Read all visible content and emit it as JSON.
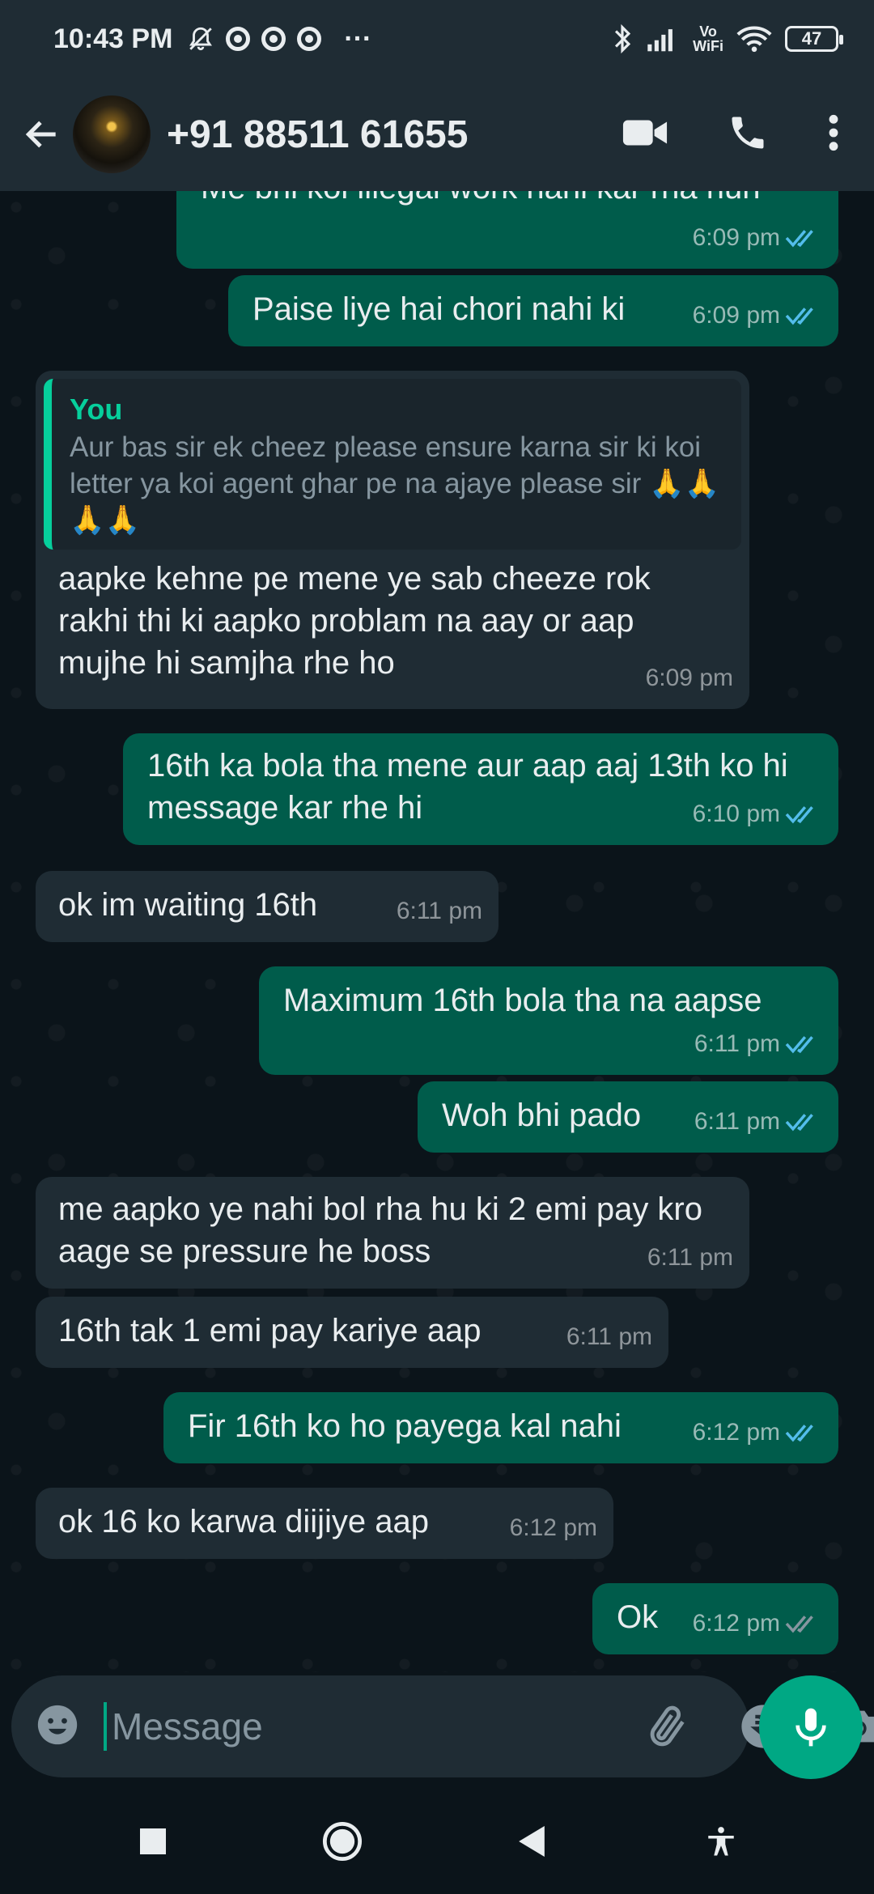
{
  "status_bar": {
    "time": "10:43 PM",
    "battery": "47",
    "volte": "Vo\nWiFi",
    "more": "···"
  },
  "header": {
    "contact_name": "+91 88511 61655"
  },
  "messages": [
    {
      "dir": "out",
      "text": "Me bhi koi illegal work nahi kar rha hun",
      "time": "6:09 pm",
      "status": "read"
    },
    {
      "dir": "out",
      "text": "Paise liye hai chori nahi ki",
      "time": "6:09 pm",
      "status": "read"
    },
    {
      "dir": "in",
      "quote_author": "You",
      "quote_text": "Aur bas sir ek cheez please ensure karna sir ki koi letter ya koi agent ghar pe na ajaye please sir 🙏🙏🙏🙏",
      "text": "aapke kehne pe mene ye sab cheeze rok rakhi thi ki aapko problam na aay or aap mujhe hi samjha rhe ho",
      "time": "6:09 pm"
    },
    {
      "dir": "out",
      "text": "16th ka bola tha mene aur aap aaj 13th ko hi message kar rhe hi",
      "time": "6:10 pm",
      "status": "read"
    },
    {
      "dir": "in",
      "text": "ok im waiting 16th",
      "time": "6:11 pm"
    },
    {
      "dir": "out",
      "text": "Maximum 16th bola tha na aapse",
      "time": "6:11 pm",
      "status": "read"
    },
    {
      "dir": "out",
      "text": "Woh bhi pado",
      "time": "6:11 pm",
      "status": "read"
    },
    {
      "dir": "in",
      "text": "me aapko ye nahi bol rha hu ki 2 emi pay kro aage se pressure he boss",
      "time": "6:11 pm"
    },
    {
      "dir": "in",
      "text": "16th tak 1 emi pay kariye aap",
      "time": "6:11 pm"
    },
    {
      "dir": "out",
      "text": "Fir 16th ko ho payega kal nahi",
      "time": "6:12 pm",
      "status": "read"
    },
    {
      "dir": "in",
      "text": "ok 16 ko karwa diijiye aap",
      "time": "6:12 pm"
    },
    {
      "dir": "out",
      "text": "Ok",
      "time": "6:12 pm",
      "status": "delivered"
    }
  ],
  "input": {
    "placeholder": "Message",
    "value": ""
  },
  "colors": {
    "outgoing": "#005c4b",
    "incoming": "#1f2c34",
    "accent": "#00a884",
    "read_tick": "#53bdeb",
    "delivered_tick": "#8696a0"
  },
  "icons": [
    "back-arrow-icon",
    "video-call-icon",
    "voice-call-icon",
    "more-options-icon",
    "emoji-icon",
    "attach-icon",
    "rupee-payment-icon",
    "camera-icon",
    "mic-icon",
    "recents-icon",
    "home-icon",
    "nav-back-icon",
    "accessibility-icon"
  ]
}
